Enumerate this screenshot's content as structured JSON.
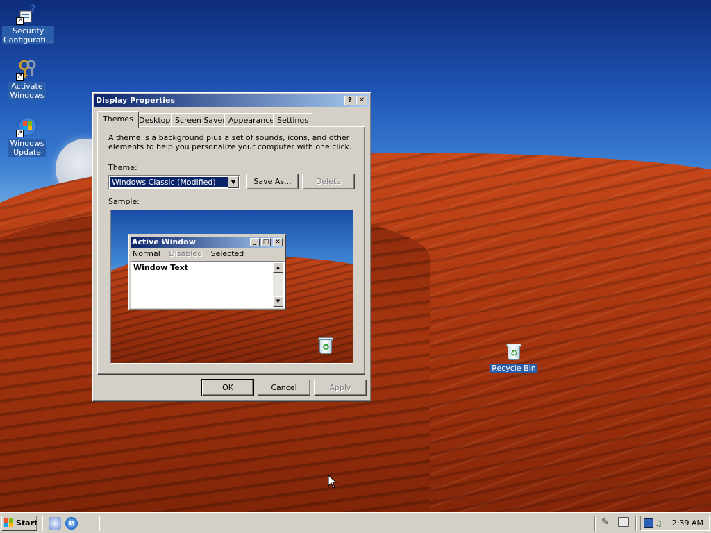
{
  "desktop": {
    "icons": [
      {
        "label_line1": "Security",
        "label_line2": "Configurati...",
        "icon": "security-configuration-icon"
      },
      {
        "label_line1": "Activate",
        "label_line2": "Windows",
        "icon": "activate-windows-keys-icon"
      },
      {
        "label_line1": "Windows",
        "label_line2": "Update",
        "icon": "windows-update-icon"
      }
    ],
    "recycle_bin": {
      "label": "Recycle Bin",
      "icon": "recycle-bin-icon"
    }
  },
  "dialog": {
    "title": "Display Properties",
    "help_button": "?",
    "close_button": "✕",
    "tabs": [
      {
        "label": "Themes",
        "active": true
      },
      {
        "label": "Desktop",
        "active": false
      },
      {
        "label": "Screen Saver",
        "active": false
      },
      {
        "label": "Appearance",
        "active": false
      },
      {
        "label": "Settings",
        "active": false
      }
    ],
    "description": "A theme is a background plus a set of sounds, icons, and other elements to help you personalize your computer with one click.",
    "theme_label": "Theme:",
    "theme_value": "Windows Classic (Modified)",
    "save_as_label": "Save As...",
    "delete_label": "Delete",
    "sample_label": "Sample:",
    "sample": {
      "window_title": "Active Window",
      "menu": [
        "Normal",
        "Disabled",
        "Selected"
      ],
      "window_text": "Window Text"
    },
    "ok_label": "OK",
    "cancel_label": "Cancel",
    "apply_label": "Apply"
  },
  "taskbar": {
    "start_label": "Start",
    "quick_launch": [
      "show-desktop-icon",
      "internet-explorer-icon"
    ],
    "tray_icons": [
      "pen-icon",
      "monitor-icon",
      "network-icon",
      "volume-icon"
    ],
    "clock": "2:39 AM"
  },
  "colors": {
    "title_active_start": "#0a246a",
    "title_active_end": "#a6caf0",
    "face": "#d4d0c8"
  }
}
